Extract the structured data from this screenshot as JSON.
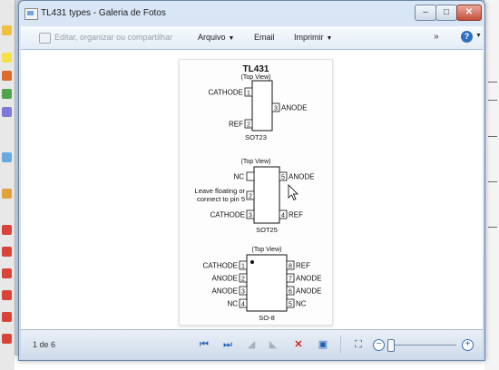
{
  "window": {
    "title": "TL431 types - Galeria de Fotos",
    "min": "–",
    "max": "□",
    "close": "✕"
  },
  "menubar": {
    "share_label": "Editar, organizar ou compartilhar",
    "arquivo": "Arquivo",
    "email": "Email",
    "imprimir": "Imprimir",
    "more": "»",
    "help": "?"
  },
  "image": {
    "title": "TL431",
    "sections": [
      {
        "top_view": "(Top View)",
        "package": "SOT23",
        "pins": [
          {
            "n": "1",
            "label": "CATHODE"
          },
          {
            "n": "2",
            "label": "REF"
          },
          {
            "n": "3",
            "label": "ANODE"
          }
        ]
      },
      {
        "top_view": "(Top View)",
        "package": "SOT25",
        "pins": [
          {
            "n": "",
            "label": "NC"
          },
          {
            "n": "2",
            "label": "Leave floating or"
          },
          {
            "n": "",
            "label": "connect to pin 5"
          },
          {
            "n": "3",
            "label": "CATHODE"
          },
          {
            "n": "5",
            "label": "ANODE"
          },
          {
            "n": "4",
            "label": "REF"
          }
        ]
      },
      {
        "top_view": "(Top View)",
        "package": "SO-8",
        "pins": [
          {
            "n": "1",
            "label": "CATHODE"
          },
          {
            "n": "2",
            "label": "ANODE"
          },
          {
            "n": "3",
            "label": "ANODE"
          },
          {
            "n": "4",
            "label": "NC"
          },
          {
            "n": "8",
            "label": "REF"
          },
          {
            "n": "7",
            "label": "ANODE"
          },
          {
            "n": "6",
            "label": "ANODE"
          },
          {
            "n": "5",
            "label": "NC"
          }
        ]
      }
    ]
  },
  "statusbar": {
    "page_count": "1 de 6"
  }
}
